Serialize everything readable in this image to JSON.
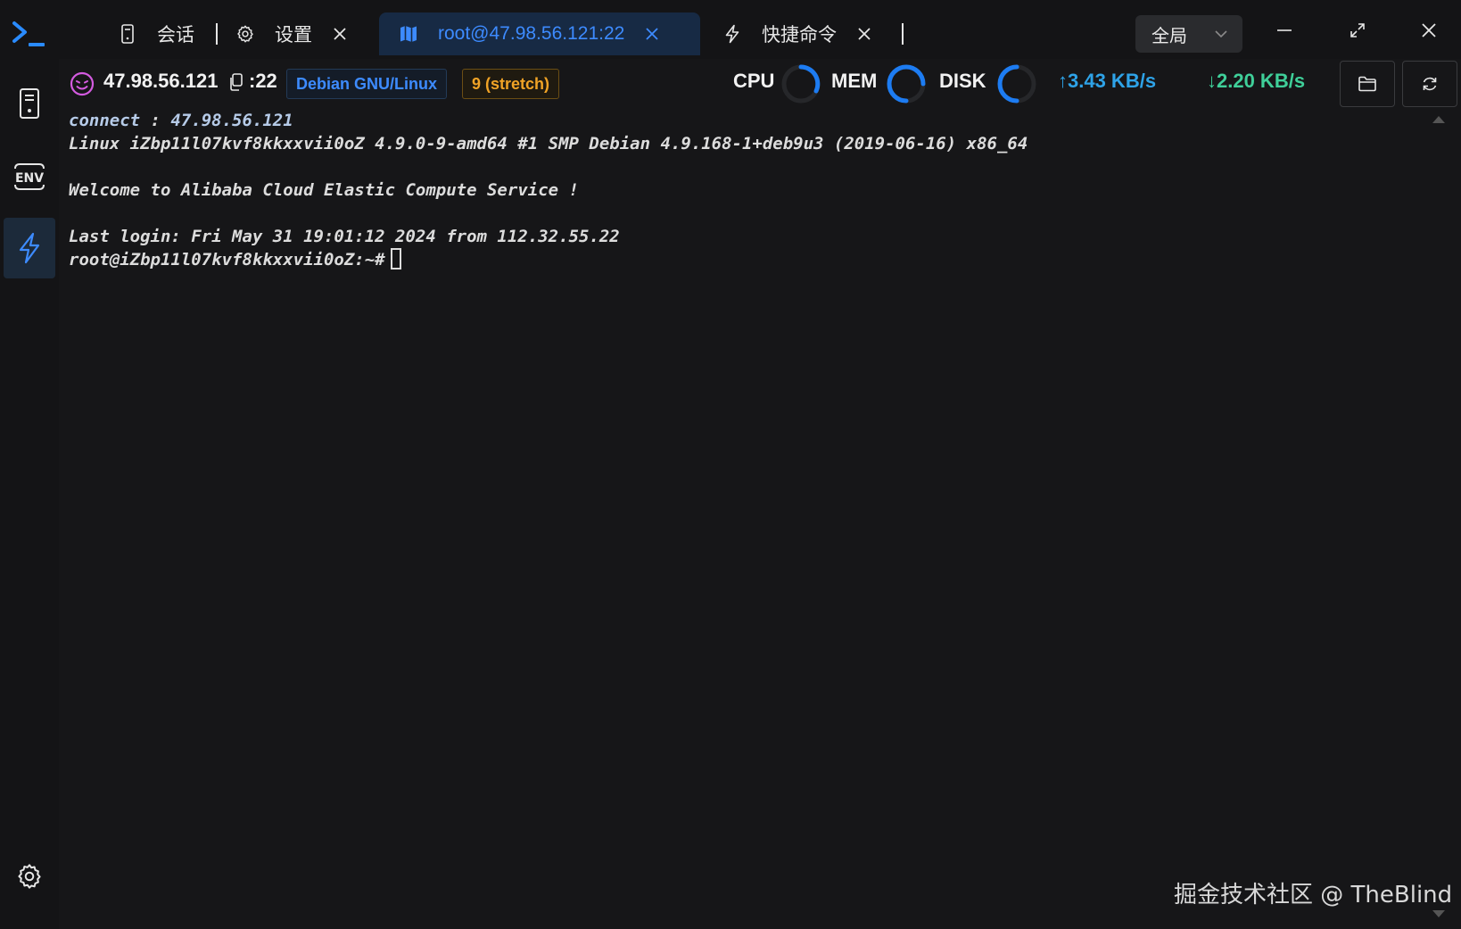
{
  "titlebar": {
    "tabs": [
      {
        "label": "会话",
        "icon": "server-icon",
        "active": false,
        "closable": false
      },
      {
        "label": "设置",
        "icon": "gear-icon",
        "active": false,
        "closable": true
      },
      {
        "label": "root@47.98.56.121:22",
        "icon": "map-icon",
        "active": true,
        "closable": true
      },
      {
        "label": "快捷命令",
        "icon": "lightning-icon",
        "active": false,
        "closable": true
      }
    ],
    "scope": {
      "selected": "全局"
    }
  },
  "sidebar": {
    "items": [
      {
        "icon": "server-icon",
        "active": false
      },
      {
        "icon": "env-icon",
        "label": "ENV",
        "active": false
      },
      {
        "icon": "lightning-icon",
        "active": true
      },
      {
        "icon": "gear-icon",
        "active": false
      }
    ]
  },
  "info": {
    "host": "47.98.56.121",
    "port": ":22",
    "os": "Debian GNU/Linux",
    "version": "9 (stretch)",
    "cpu_label": "CPU",
    "mem_label": "MEM",
    "disk_label": "DISK",
    "upload": "↑3.43 KB/s",
    "download": "↓2.20 KB/s"
  },
  "terminal": {
    "connect_key": "connect",
    "connect_sep": " : ",
    "connect_val": "47.98.56.121",
    "lines": [
      "Linux iZbp11l07kvf8kkxxvii0oZ 4.9.0-9-amd64 #1 SMP Debian 4.9.168-1+deb9u3 (2019-06-16) x86_64",
      "",
      "Welcome to Alibaba Cloud Elastic Compute Service !",
      "",
      "Last login: Fri May 31 19:01:12 2024 from 112.32.55.22"
    ],
    "prompt": "root@iZbp11l07kvf8kkxxvii0oZ:~#"
  },
  "colors": {
    "accent": "#3d8bff",
    "version_badge": "#f0a326",
    "upload": "#2ea3e8",
    "download": "#3fcf99",
    "background": "#161618"
  },
  "watermark": "掘金技术社区 @ TheBlind"
}
